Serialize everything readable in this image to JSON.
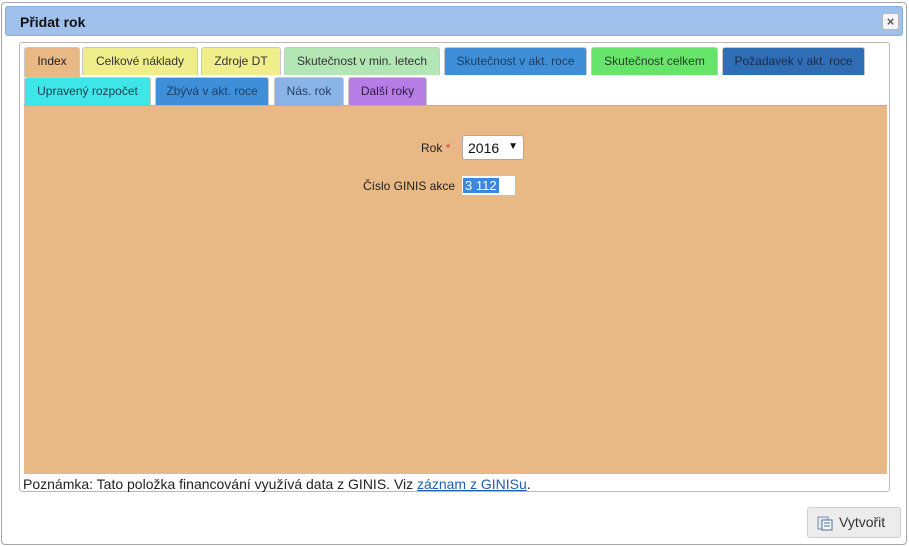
{
  "dialog": {
    "title": "Přidat rok",
    "close_icon": "×"
  },
  "tabs": [
    {
      "label": "Index",
      "bg": "#e8b885",
      "fg": "#222222"
    },
    {
      "label": "Celkové náklady",
      "bg": "#efee8a",
      "fg": "#333333"
    },
    {
      "label": "Zdroje DT",
      "bg": "#efee8a",
      "fg": "#333333"
    },
    {
      "label": "Skutečnost v min. letech",
      "bg": "#b3e6b5",
      "fg": "#333333"
    },
    {
      "label": "Skutečnost v akt. roce",
      "bg": "#3f8fd8",
      "fg": "#1b3f66"
    },
    {
      "label": "Skutečnost celkem",
      "bg": "#67e46a",
      "fg": "#2a3d2a"
    },
    {
      "label": "Požadavek v akt. roce",
      "bg": "#2f6db4",
      "fg": "#1a2d4a"
    },
    {
      "label": "Upravený rozpočet",
      "bg": "#3ee6ea",
      "fg": "#1f3c4a"
    },
    {
      "label": "Zbývá v akt. roce",
      "bg": "#3f8fd8",
      "fg": "#1b3f66"
    },
    {
      "label": "Nás. rok",
      "bg": "#8ab4e8",
      "fg": "#253f66"
    },
    {
      "label": "Další roky",
      "bg": "#b67de6",
      "fg": "#2d1e40"
    }
  ],
  "form": {
    "year_label": "Rok",
    "required_mark": "*",
    "year_value": "2016",
    "year_arrow": "▼",
    "ginis_label": "Číslo GINIS akce",
    "ginis_value": "3 112"
  },
  "note": {
    "text": "Poznámka: Tato položka financování využívá data z GINIS. Viz ",
    "link": "záznam z GINISu",
    "suffix": "."
  },
  "footer": {
    "create_label": "Vytvořit"
  }
}
